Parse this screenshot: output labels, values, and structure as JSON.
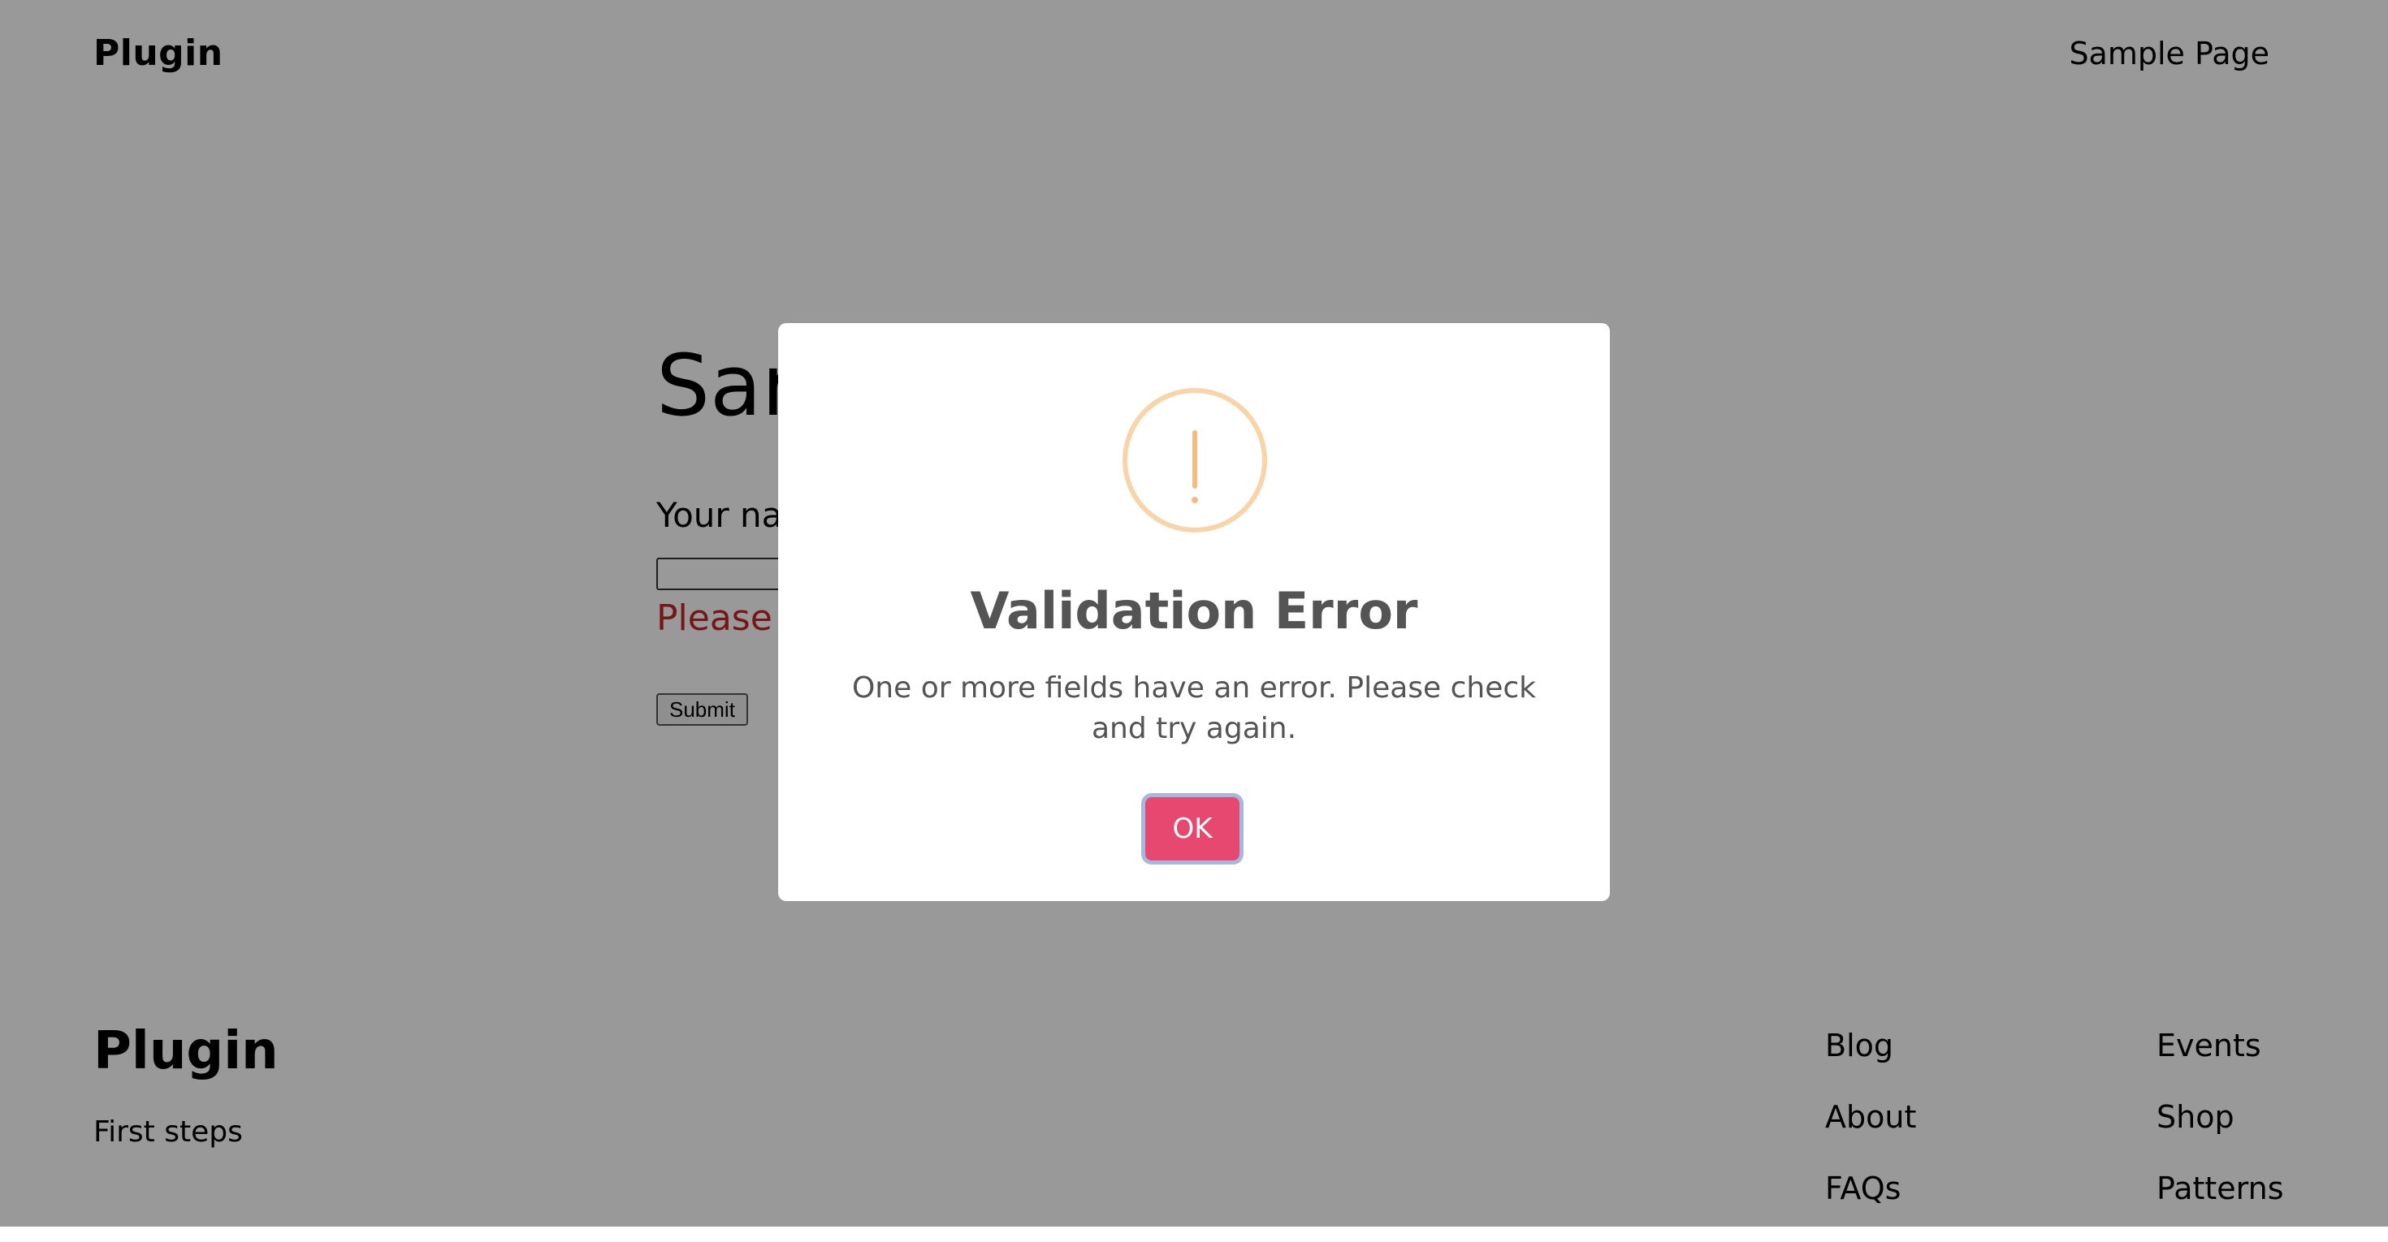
{
  "header": {
    "site_title": "Plugin",
    "nav_link": "Sample Page"
  },
  "content": {
    "heading_visible": "Sar",
    "field_label_visible": "Your nar",
    "error_text_visible": "Please t",
    "submit_label": "Submit"
  },
  "footer": {
    "title": "Plugin",
    "tagline": "First steps",
    "col1": [
      "Blog",
      "About",
      "FAQs"
    ],
    "col2": [
      "Events",
      "Shop",
      "Patterns"
    ]
  },
  "modal": {
    "icon": "exclamation-warning-icon",
    "title": "Validation Error",
    "message": "One or more fields have an error. Please check and try again.",
    "ok_label": "OK"
  },
  "colors": {
    "accent_button": "#e7486f",
    "warning_icon": "#f8d4a8",
    "error_text": "#c3262b",
    "overlay": "rgba(0,0,0,0.4)"
  }
}
